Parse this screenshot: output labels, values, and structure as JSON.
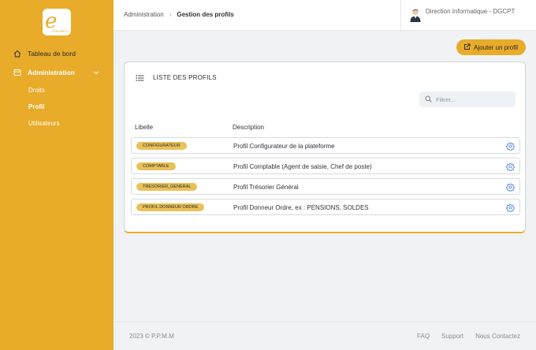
{
  "brand": {
    "logo_caption": "FORUMKEY"
  },
  "sidebar": {
    "items": [
      {
        "label": "Tableau de bord",
        "icon": "home-icon"
      },
      {
        "label": "Administration",
        "icon": "layout-icon",
        "expanded": true
      }
    ],
    "subitems": [
      {
        "label": "Droits",
        "active": false
      },
      {
        "label": "Profil",
        "active": true
      },
      {
        "label": "Utilisateurs",
        "active": false
      }
    ]
  },
  "breadcrumb": {
    "parent": "Administration",
    "separator": "›",
    "current": "Gestion des profils"
  },
  "user": {
    "name": "Direction Informatique - DGCPT"
  },
  "actions": {
    "add_label": "Ajouter un profil"
  },
  "card": {
    "title": "LISTE DES PROFILS",
    "filter_placeholder": "Filtrer...",
    "columns": {
      "libelle": "Libelle",
      "description": "Description"
    },
    "rows": [
      {
        "badge": "CONFIGURATEUR",
        "description": "Profil Configurateur de la plateforme"
      },
      {
        "badge": "COMPTABLE",
        "description": "Profil Comptable (Agent de saisie, Chef de poste)"
      },
      {
        "badge": "TRESORIER_GENERAL",
        "description": "Profil Trésorier Général"
      },
      {
        "badge": "PROFIL DONNEUR ORDRE",
        "description": "Profil Donneur Ordre, ex : PENSIONS, SOLDES"
      }
    ]
  },
  "footer": {
    "copyright": "2023 © P.P.M.M",
    "links": [
      "FAQ",
      "Support",
      "Nous Contactez"
    ]
  },
  "colors": {
    "accent": "#e8ab2a",
    "badge": "#e8c158",
    "gear": "#3a7bd5"
  }
}
